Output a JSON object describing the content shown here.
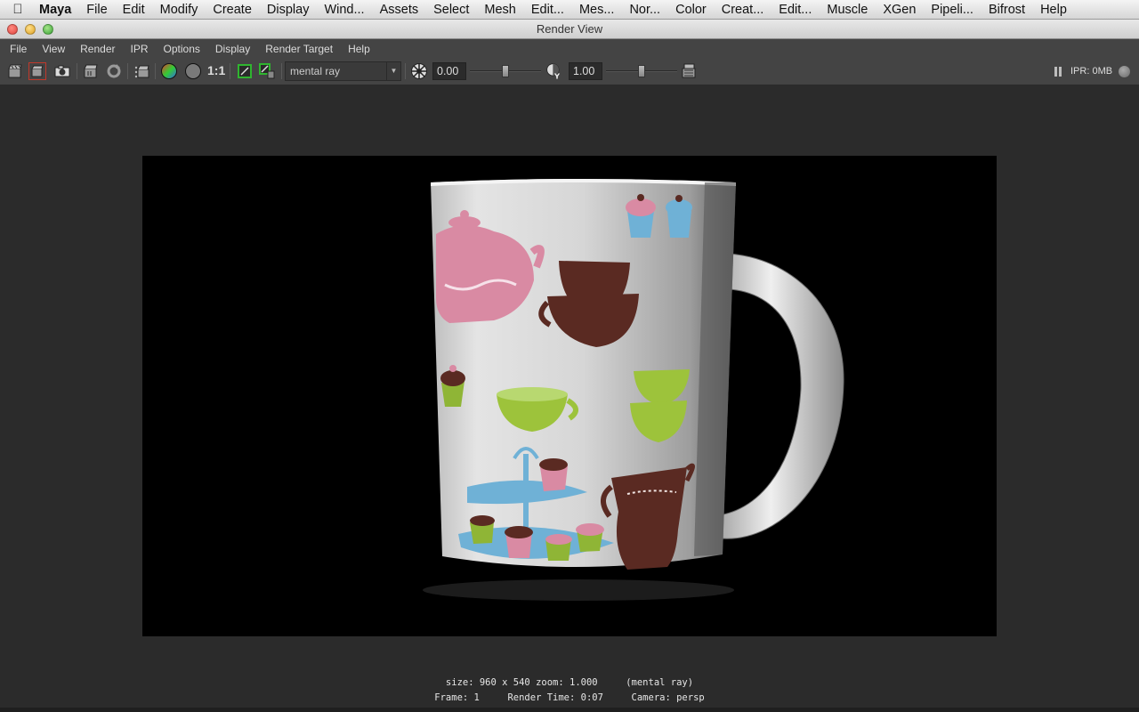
{
  "mac_menu": {
    "app": "Maya",
    "items": [
      "File",
      "Edit",
      "Modify",
      "Create",
      "Display",
      "Wind...",
      "Assets",
      "Select",
      "Mesh",
      "Edit...",
      "Mes...",
      "Nor...",
      "Color",
      "Creat...",
      "Edit...",
      "Muscle",
      "XGen",
      "Pipeli...",
      "Bifrost",
      "Help"
    ]
  },
  "window": {
    "title": "Render View"
  },
  "window_menu": [
    "File",
    "View",
    "Render",
    "IPR",
    "Options",
    "Display",
    "Render Target",
    "Help"
  ],
  "toolbar": {
    "ratio_label": "1:1",
    "renderer": "mental ray",
    "exposure": "0.00",
    "gamma": "1.00",
    "exposure_level": 0.5,
    "gamma_level": 0.5,
    "ipr_memory": "IPR: 0MB"
  },
  "status": {
    "line1": "size: 960 x 540 zoom: 1.000     (mental ray)",
    "line2": "Frame: 1     Render Time: 0:07     Camera: persp"
  }
}
